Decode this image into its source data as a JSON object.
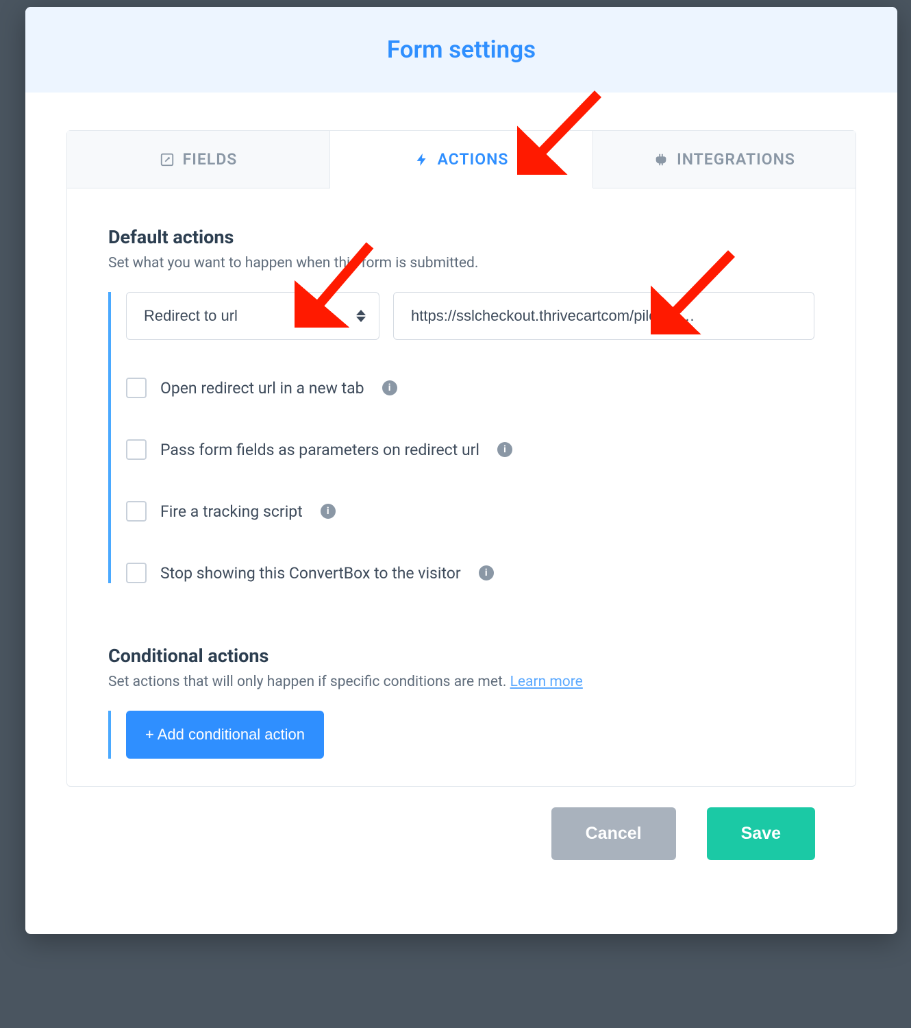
{
  "modal": {
    "title": "Form settings"
  },
  "tabs": {
    "fields": "FIELDS",
    "actions": "ACTIONS",
    "integrations": "INTEGRATIONS",
    "active": "actions"
  },
  "default_actions": {
    "title": "Default actions",
    "subtitle": "Set what you want to happen when this form is submitted.",
    "action_type": "Redirect to url",
    "redirect_url": "https://sslcheckout.thrivecartcom/pilot-pr…",
    "options": [
      {
        "key": "open_new_tab",
        "label": "Open redirect url in a new tab",
        "checked": false,
        "has_info": true
      },
      {
        "key": "pass_params",
        "label": "Pass form fields as parameters on redirect url",
        "checked": false,
        "has_info": true
      },
      {
        "key": "fire_tracking",
        "label": "Fire a tracking script",
        "checked": false,
        "has_info": true
      },
      {
        "key": "stop_showing",
        "label": "Stop showing this ConvertBox to the visitor",
        "checked": false,
        "has_info": true
      }
    ]
  },
  "conditional_actions": {
    "title": "Conditional actions",
    "subtitle": "Set actions that will only happen if specific conditions are met. ",
    "learn_more": "Learn more",
    "add_button": "+ Add conditional action"
  },
  "footer": {
    "cancel": "Cancel",
    "save": "Save"
  }
}
